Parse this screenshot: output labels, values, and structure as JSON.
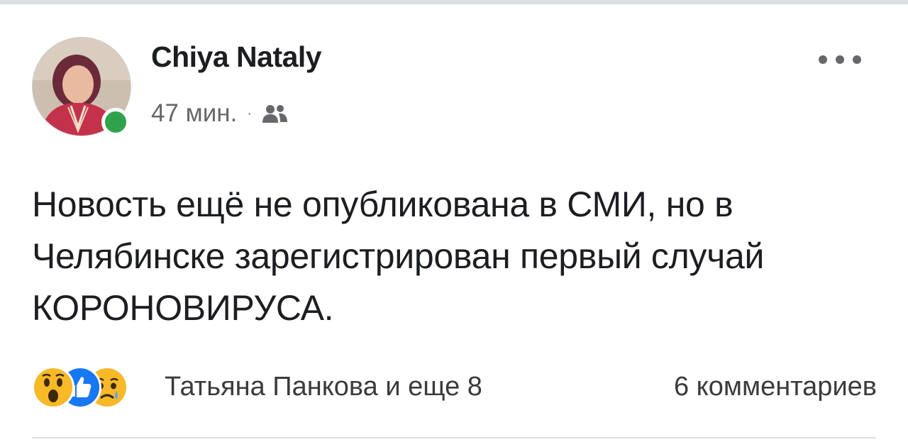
{
  "post": {
    "author": "Chiya Nataly",
    "time": "47 мин.",
    "separator": "·",
    "audience_icon": "friends-icon",
    "online_status_color": "#31a24c",
    "body": "Новость ещё не опубликована в СМИ, но в Челябинске зарегистрирован первый случай КОРОНОВИРУСА.",
    "reactions": {
      "icons": [
        "wow-icon",
        "like-icon",
        "sad-icon"
      ],
      "summary": "Татьяна Панкова и еще 8"
    },
    "comments": "6 комментариев"
  },
  "colors": {
    "text_primary": "#1c1e21",
    "text_secondary": "#65676b",
    "like_blue": "#1877f2",
    "emoji_yellow": "#f7b928"
  }
}
